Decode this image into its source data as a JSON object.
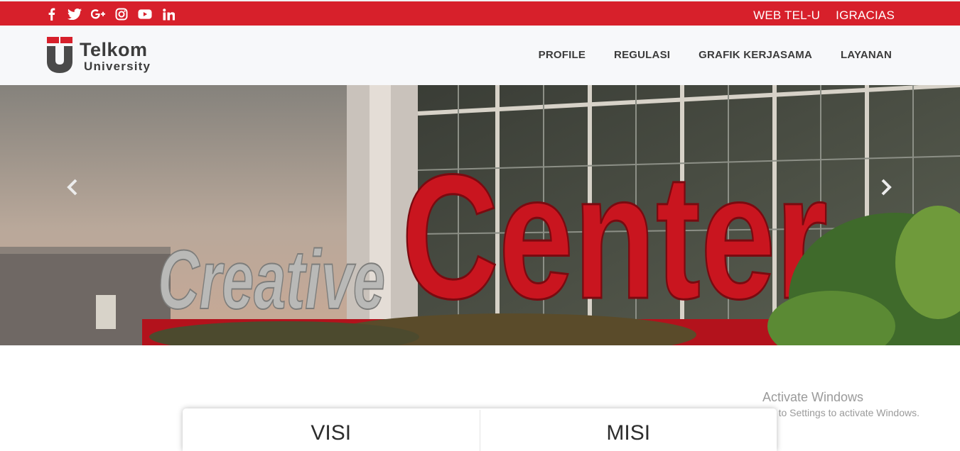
{
  "topbar": {
    "social_icons": [
      "facebook-icon",
      "twitter-icon",
      "google-plus-icon",
      "instagram-icon",
      "youtube-icon",
      "linkedin-icon"
    ],
    "links": [
      "WEB TEL-U",
      "IGRACIAS"
    ]
  },
  "navbar": {
    "logo_line1": "Telkom",
    "logo_line2": "University",
    "menu": [
      "PROFILE",
      "REGULASI",
      "GRAFIK KERJASAMA",
      "LAYANAN"
    ]
  },
  "hero": {
    "sign_word1": "Creative",
    "sign_word2": "Center",
    "prev_icon": "chevron-left-icon",
    "next_icon": "chevron-right-icon"
  },
  "watermark": {
    "title": "Activate Windows",
    "subtitle": "Go to Settings to activate Windows."
  },
  "sections": [
    "VISI",
    "MISI"
  ],
  "colors": {
    "brand_red": "#d7202b",
    "navbar_bg": "#f7f8fa",
    "text_dark": "#3b3b3b"
  }
}
